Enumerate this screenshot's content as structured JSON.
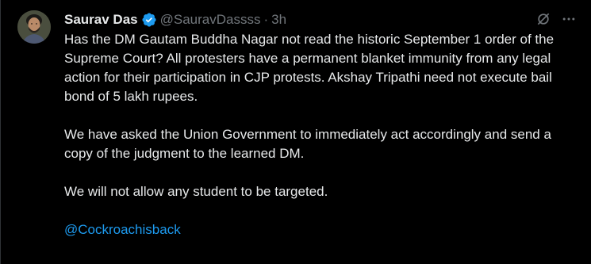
{
  "tweet": {
    "author": {
      "display_name": "Saurav Das",
      "handle": "@SauravDassss",
      "separator": "·",
      "time": "3h",
      "avatar_icon": "profile-photo",
      "verified_icon": "verified-badge-icon",
      "verified_color": "#1d9bf0"
    },
    "actions": {
      "grok_icon": "grok-icon",
      "more_icon": "more-options-icon"
    },
    "paragraphs": [
      "Has the DM Gautam Buddha Nagar not read the historic September 1 order of the Supreme Court? All protesters have a permanent blanket immunity from any legal action for their participation in CJP protests. Akshay Tripathi need not execute bail bond of 5 lakh rupees.",
      "We have asked the Union Government to immediately act accordingly and send a copy of the judgment to the learned DM.",
      "We will not allow any student to be targeted."
    ],
    "mention": "@Cockroachisback",
    "colors": {
      "background": "#000000",
      "text": "#e7e9ea",
      "secondary": "#71767b",
      "link": "#1d9bf0"
    }
  }
}
